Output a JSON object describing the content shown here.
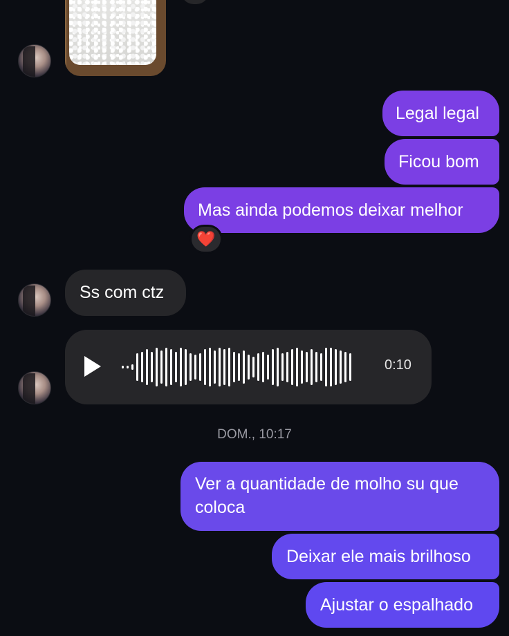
{
  "messages": {
    "sent_1": "Legal legal",
    "sent_2": "Ficou bom",
    "sent_3": "Mas ainda podemos deixar melhor",
    "reaction": "❤️",
    "received_1": "Ss com ctz",
    "audio": {
      "duration": "0:10",
      "icon": "play-icon"
    },
    "timestamp": "DOM., 10:17",
    "sent_4_line1": "Ver a quantidade de molho su que",
    "sent_4_line2": "coloca",
    "sent_5": "Deixar ele mais brilhoso",
    "sent_6": "Ajustar o espalhado"
  },
  "colors": {
    "background": "#0b0d13",
    "outgoing_bubble": "#7b3fe4",
    "incoming_bubble": "#262629",
    "timestamp_text": "#9a9aa3"
  }
}
